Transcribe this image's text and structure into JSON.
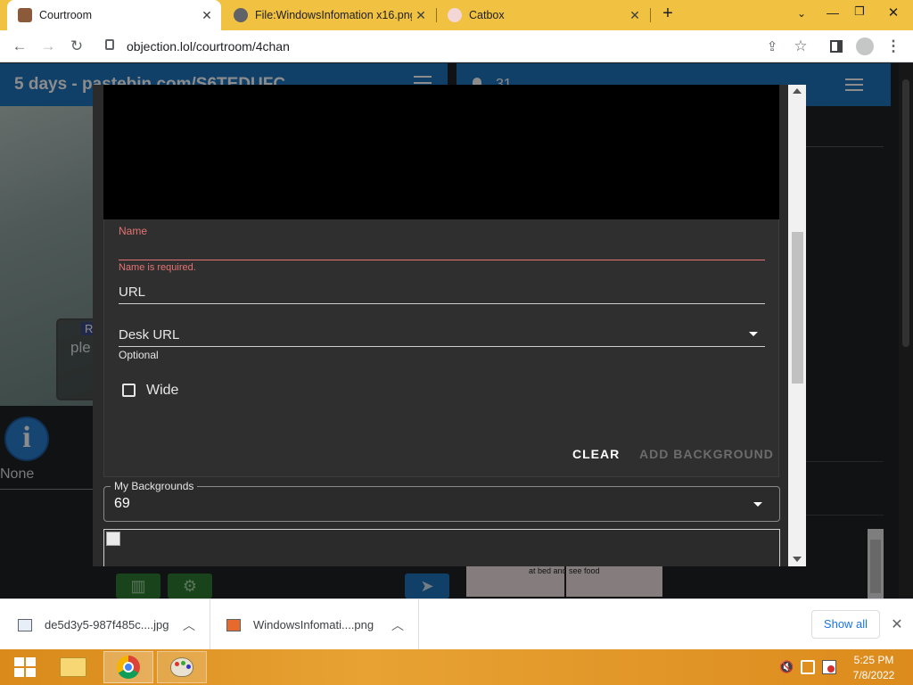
{
  "browser": {
    "tabs": [
      {
        "title": "Courtroom",
        "active": true
      },
      {
        "title": "File:WindowsInfomation x16.png",
        "active": false
      },
      {
        "title": "Catbox",
        "active": false
      }
    ],
    "url": "objection.lol/courtroom/4chan"
  },
  "app": {
    "left_title": "5 days - pastebin.com/S6TEDUFC",
    "viewer_count": "31",
    "scene_box_label": "Ra",
    "scene_box_text": "ple",
    "none_label": "None",
    "comic_caption": "at bed and see food"
  },
  "dialog": {
    "name_label": "Name",
    "name_error": "Name is required.",
    "url_label": "URL",
    "desk_url_label": "Desk URL",
    "desk_url_helper": "Optional",
    "wide_label": "Wide",
    "clear_button": "CLEAR",
    "add_background_button": "ADD BACKGROUND",
    "my_backgrounds_label": "My Backgrounds",
    "my_backgrounds_value": "69"
  },
  "downloads": {
    "items": [
      {
        "name": "de5d3y5-987f485c....jpg"
      },
      {
        "name": "WindowsInfomati....png"
      }
    ],
    "show_all": "Show all"
  },
  "taskbar": {
    "time": "5:25 PM",
    "date": "7/8/2022"
  },
  "colors": {
    "accent_blue": "#1e73be",
    "error_red": "#e57373",
    "tab_strip": "#f1c141",
    "taskbar": "#e7a233"
  }
}
